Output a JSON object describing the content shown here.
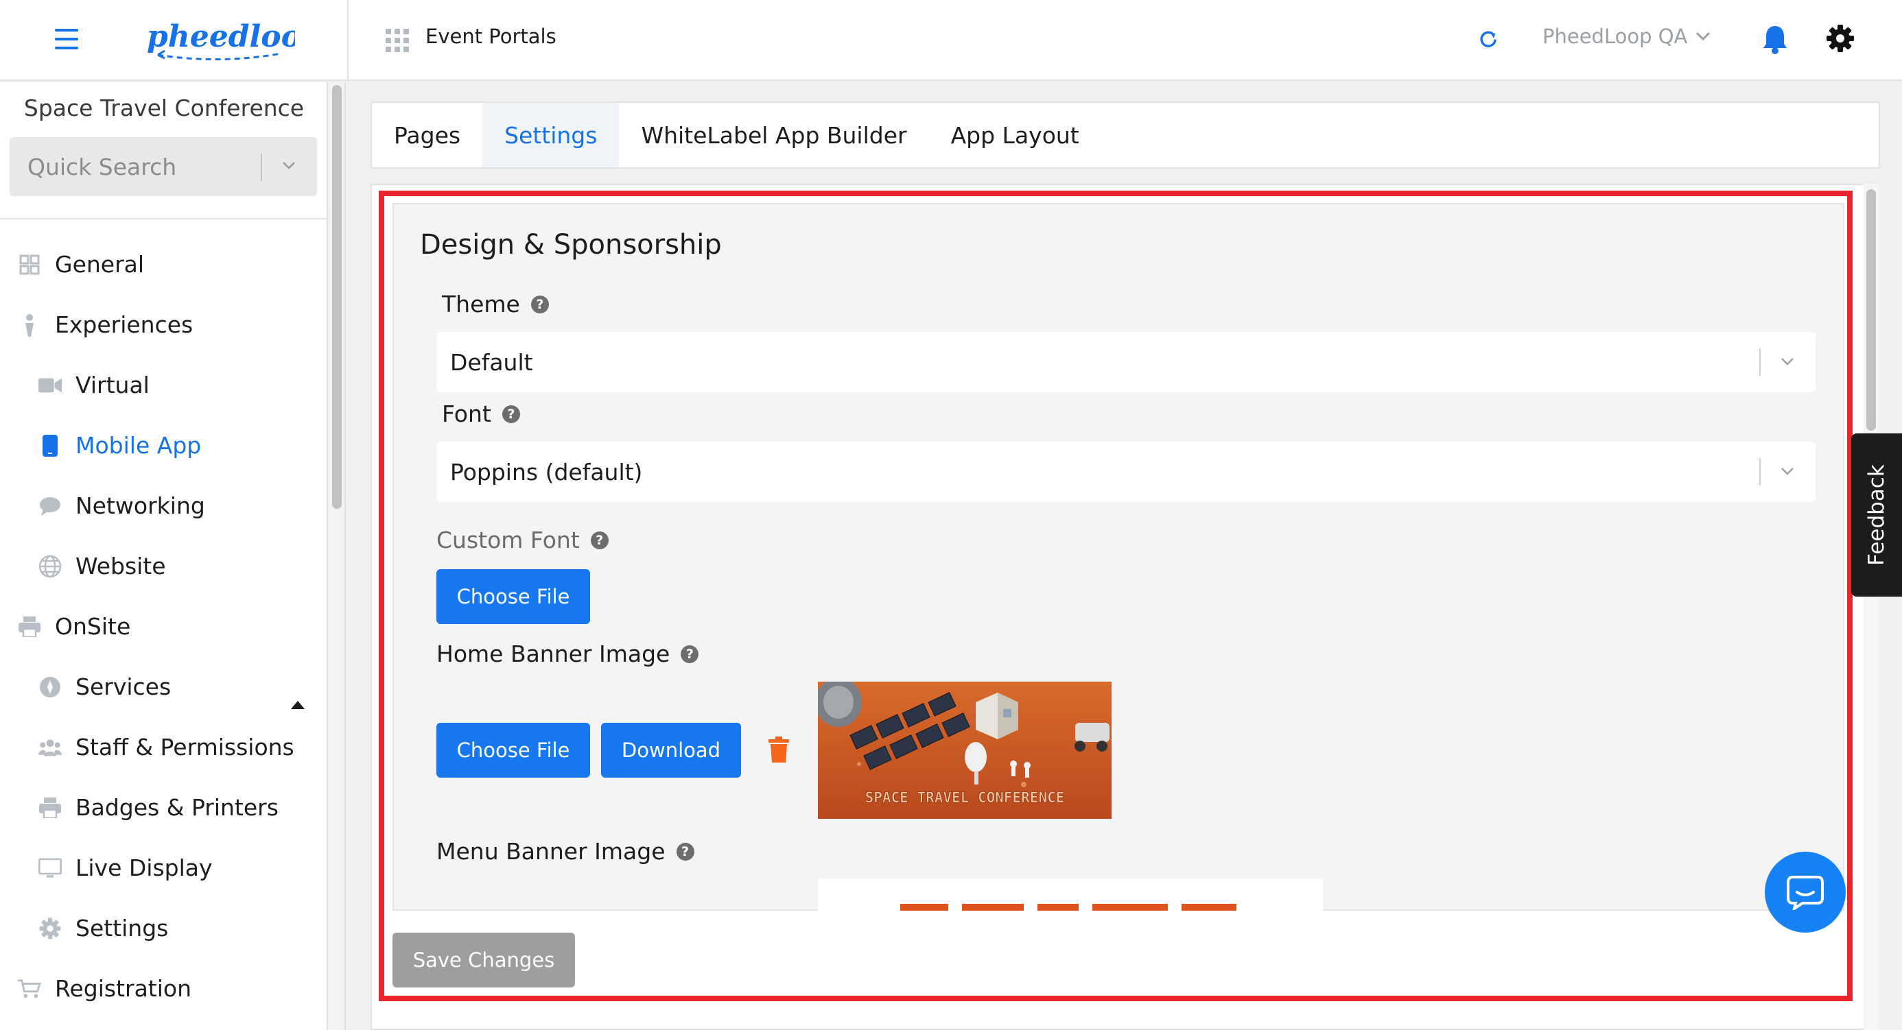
{
  "header": {
    "portal_title": "Event Portals",
    "account_name": "PheedLoop QA",
    "logo_text": "pheedloop"
  },
  "sidebar": {
    "event_name": "Space Travel Conference",
    "search_placeholder": "Quick Search",
    "items": [
      {
        "label": "General",
        "icon": "grid-icon"
      },
      {
        "label": "Experiences",
        "icon": "person-icon"
      },
      {
        "label": "Virtual",
        "icon": "video-icon"
      },
      {
        "label": "Mobile App",
        "icon": "phone-icon",
        "active": true
      },
      {
        "label": "Networking",
        "icon": "chat-bubble-icon"
      },
      {
        "label": "Website",
        "icon": "globe-icon"
      },
      {
        "label": "OnSite",
        "icon": "printer-icon",
        "expanded": true
      },
      {
        "label": "Services",
        "icon": "compass-icon"
      },
      {
        "label": "Staff & Permissions",
        "icon": "people-icon"
      },
      {
        "label": "Badges & Printers",
        "icon": "printer-icon"
      },
      {
        "label": "Live Display",
        "icon": "monitor-icon"
      },
      {
        "label": "Settings",
        "icon": "gear-icon"
      },
      {
        "label": "Registration",
        "icon": "cart-icon"
      }
    ]
  },
  "tabs": [
    {
      "label": "Pages"
    },
    {
      "label": "Settings",
      "active": true
    },
    {
      "label": "WhiteLabel App Builder"
    },
    {
      "label": "App Layout"
    }
  ],
  "form": {
    "section_title": "Design & Sponsorship",
    "theme_label": "Theme",
    "theme_value": "Default",
    "font_label": "Font",
    "font_value": "Poppins (default)",
    "custom_font_label": "Custom Font",
    "choose_file_label": "Choose File",
    "home_banner_label": "Home Banner Image",
    "download_label": "Download",
    "banner_caption": "SPACE TRAVEL CONFERENCE",
    "menu_banner_label": "Menu Banner Image",
    "save_label": "Save Changes"
  },
  "feedback_label": "Feedback",
  "colors": {
    "accent": "#1672e6",
    "button": "#1677ee",
    "highlight": "#e8242c",
    "trash": "#f4661b",
    "disabled": "#9e9e9e"
  }
}
